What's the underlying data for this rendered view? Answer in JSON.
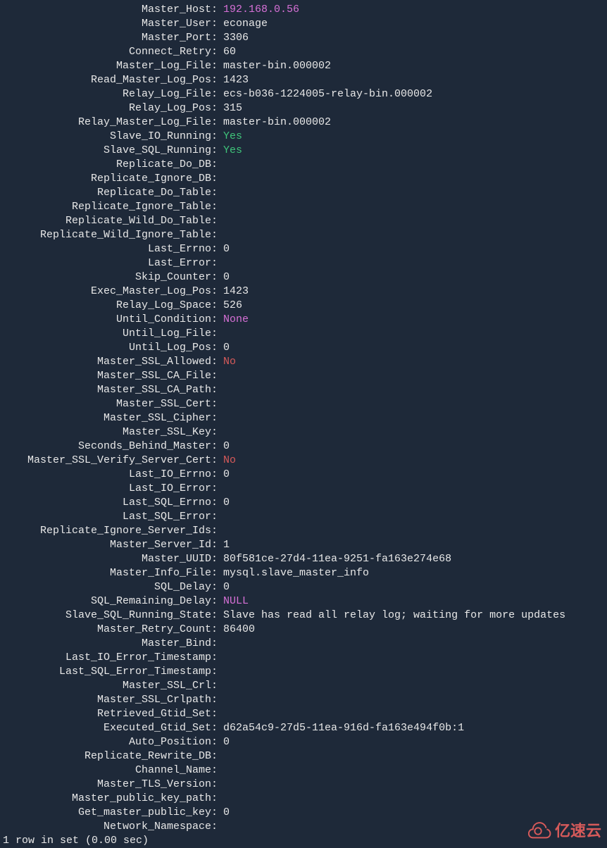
{
  "rows": [
    {
      "key": "Master_Host",
      "value": "192.168.0.56",
      "cls": "magenta"
    },
    {
      "key": "Master_User",
      "value": "econage",
      "cls": ""
    },
    {
      "key": "Master_Port",
      "value": "3306",
      "cls": ""
    },
    {
      "key": "Connect_Retry",
      "value": "60",
      "cls": ""
    },
    {
      "key": "Master_Log_File",
      "value": "master-bin.000002",
      "cls": ""
    },
    {
      "key": "Read_Master_Log_Pos",
      "value": "1423",
      "cls": ""
    },
    {
      "key": "Relay_Log_File",
      "value": "ecs-b036-1224005-relay-bin.000002",
      "cls": ""
    },
    {
      "key": "Relay_Log_Pos",
      "value": "315",
      "cls": ""
    },
    {
      "key": "Relay_Master_Log_File",
      "value": "master-bin.000002",
      "cls": ""
    },
    {
      "key": "Slave_IO_Running",
      "value": "Yes",
      "cls": "green"
    },
    {
      "key": "Slave_SQL_Running",
      "value": "Yes",
      "cls": "green"
    },
    {
      "key": "Replicate_Do_DB",
      "value": "",
      "cls": ""
    },
    {
      "key": "Replicate_Ignore_DB",
      "value": "",
      "cls": ""
    },
    {
      "key": "Replicate_Do_Table",
      "value": "",
      "cls": ""
    },
    {
      "key": "Replicate_Ignore_Table",
      "value": "",
      "cls": ""
    },
    {
      "key": "Replicate_Wild_Do_Table",
      "value": "",
      "cls": ""
    },
    {
      "key": "Replicate_Wild_Ignore_Table",
      "value": "",
      "cls": ""
    },
    {
      "key": "Last_Errno",
      "value": "0",
      "cls": ""
    },
    {
      "key": "Last_Error",
      "value": "",
      "cls": ""
    },
    {
      "key": "Skip_Counter",
      "value": "0",
      "cls": ""
    },
    {
      "key": "Exec_Master_Log_Pos",
      "value": "1423",
      "cls": ""
    },
    {
      "key": "Relay_Log_Space",
      "value": "526",
      "cls": ""
    },
    {
      "key": "Until_Condition",
      "value": "None",
      "cls": "magenta"
    },
    {
      "key": "Until_Log_File",
      "value": "",
      "cls": ""
    },
    {
      "key": "Until_Log_Pos",
      "value": "0",
      "cls": ""
    },
    {
      "key": "Master_SSL_Allowed",
      "value": "No",
      "cls": "red"
    },
    {
      "key": "Master_SSL_CA_File",
      "value": "",
      "cls": ""
    },
    {
      "key": "Master_SSL_CA_Path",
      "value": "",
      "cls": ""
    },
    {
      "key": "Master_SSL_Cert",
      "value": "",
      "cls": ""
    },
    {
      "key": "Master_SSL_Cipher",
      "value": "",
      "cls": ""
    },
    {
      "key": "Master_SSL_Key",
      "value": "",
      "cls": ""
    },
    {
      "key": "Seconds_Behind_Master",
      "value": "0",
      "cls": ""
    },
    {
      "key": "Master_SSL_Verify_Server_Cert",
      "value": "No",
      "cls": "red"
    },
    {
      "key": "Last_IO_Errno",
      "value": "0",
      "cls": ""
    },
    {
      "key": "Last_IO_Error",
      "value": "",
      "cls": ""
    },
    {
      "key": "Last_SQL_Errno",
      "value": "0",
      "cls": ""
    },
    {
      "key": "Last_SQL_Error",
      "value": "",
      "cls": ""
    },
    {
      "key": "Replicate_Ignore_Server_Ids",
      "value": "",
      "cls": ""
    },
    {
      "key": "Master_Server_Id",
      "value": "1",
      "cls": ""
    },
    {
      "key": "Master_UUID",
      "value": "80f581ce-27d4-11ea-9251-fa163e274e68",
      "cls": ""
    },
    {
      "key": "Master_Info_File",
      "value": "mysql.slave_master_info",
      "cls": ""
    },
    {
      "key": "SQL_Delay",
      "value": "0",
      "cls": ""
    },
    {
      "key": "SQL_Remaining_Delay",
      "value": "NULL",
      "cls": "magenta"
    },
    {
      "key": "Slave_SQL_Running_State",
      "value": "Slave has read all relay log; waiting for more updates",
      "cls": ""
    },
    {
      "key": "Master_Retry_Count",
      "value": "86400",
      "cls": ""
    },
    {
      "key": "Master_Bind",
      "value": "",
      "cls": ""
    },
    {
      "key": "Last_IO_Error_Timestamp",
      "value": "",
      "cls": ""
    },
    {
      "key": "Last_SQL_Error_Timestamp",
      "value": "",
      "cls": ""
    },
    {
      "key": "Master_SSL_Crl",
      "value": "",
      "cls": ""
    },
    {
      "key": "Master_SSL_Crlpath",
      "value": "",
      "cls": ""
    },
    {
      "key": "Retrieved_Gtid_Set",
      "value": "",
      "cls": ""
    },
    {
      "key": "Executed_Gtid_Set",
      "value": "d62a54c9-27d5-11ea-916d-fa163e494f0b:1",
      "cls": ""
    },
    {
      "key": "Auto_Position",
      "value": "0",
      "cls": ""
    },
    {
      "key": "Replicate_Rewrite_DB",
      "value": "",
      "cls": ""
    },
    {
      "key": "Channel_Name",
      "value": "",
      "cls": ""
    },
    {
      "key": "Master_TLS_Version",
      "value": "",
      "cls": ""
    },
    {
      "key": "Master_public_key_path",
      "value": "",
      "cls": ""
    },
    {
      "key": "Get_master_public_key",
      "value": "0",
      "cls": ""
    },
    {
      "key": "Network_Namespace",
      "value": "",
      "cls": ""
    }
  ],
  "footer_text": "1 row in set (0.00 sec)",
  "watermark_text": "亿速云"
}
